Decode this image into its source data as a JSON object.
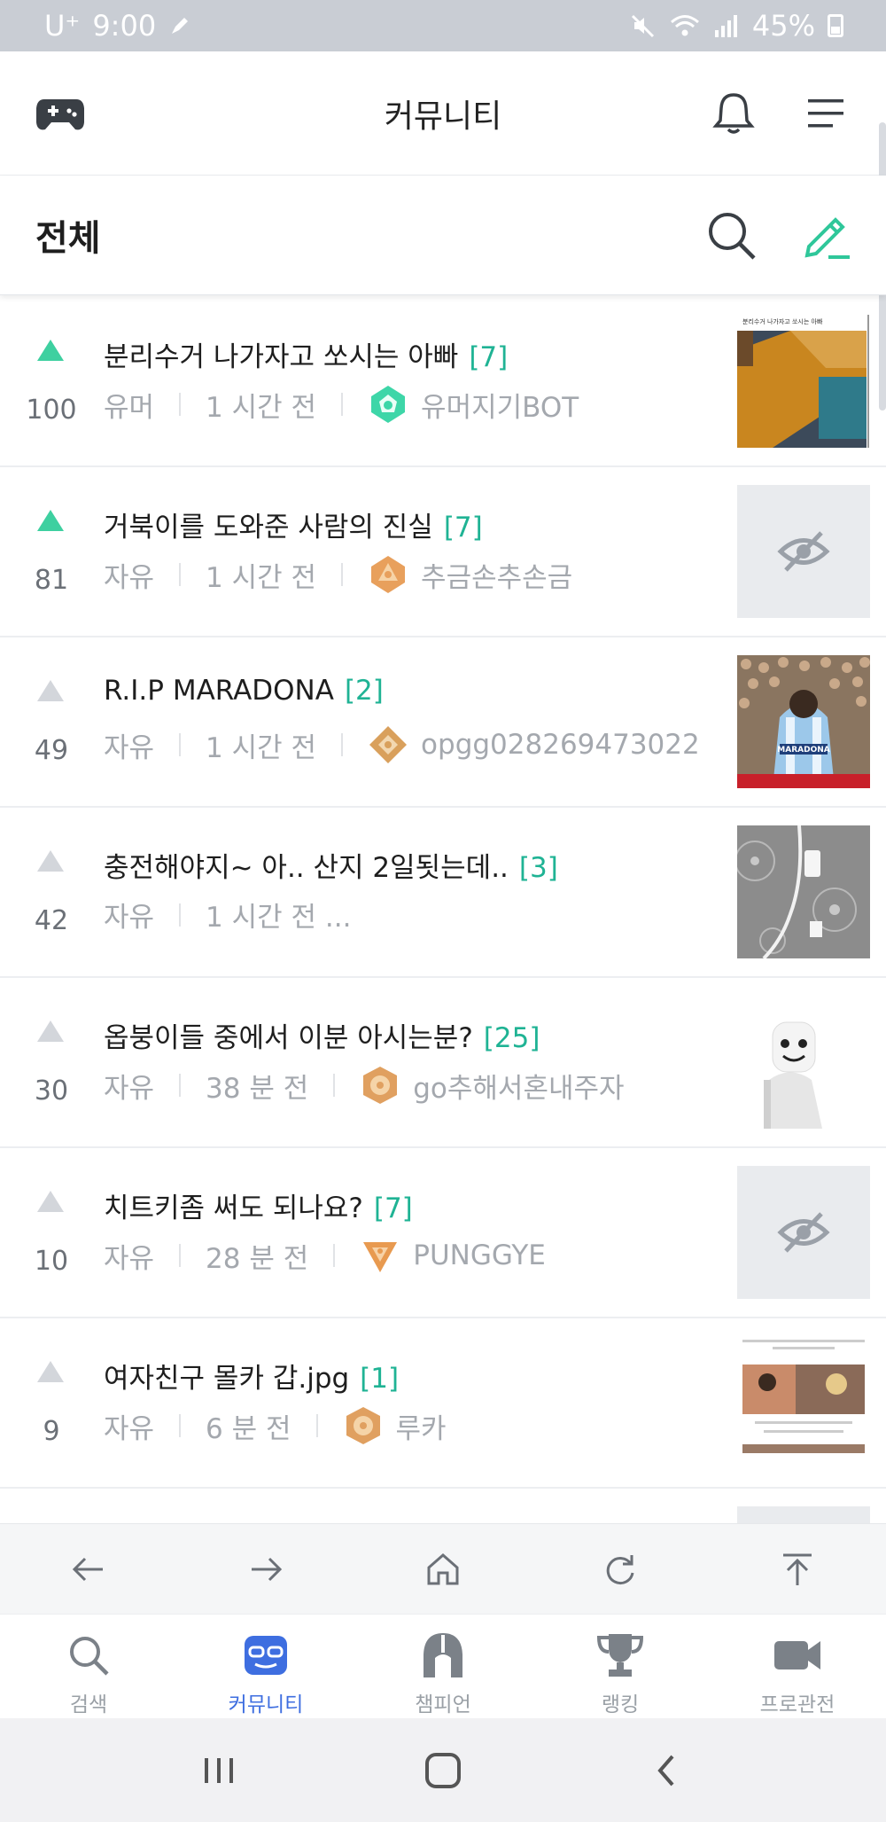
{
  "status_bar": {
    "carrier": "U⁺",
    "time": "9:00",
    "battery": "45%"
  },
  "header": {
    "title": "커뮤니티"
  },
  "section": {
    "title": "전체"
  },
  "posts": [
    {
      "votes": "100",
      "hot": true,
      "title": "분리수거 나가자고 쏘시는 아빠",
      "comments": "[7]",
      "category": "유머",
      "time": "1 시간 전",
      "author": "유머지기BOT",
      "badge_color": "#3ed6a8",
      "thumbnail": "photo",
      "thumbnail_caption": "분리수거 나가자고 쏘시는 아빠"
    },
    {
      "votes": "81",
      "hot": true,
      "title": "거북이를 도와준 사람의 진실",
      "comments": "[7]",
      "category": "자유",
      "time": "1 시간 전",
      "author": "추금손추손금",
      "badge_color": "#e8a05c",
      "thumbnail": "hidden"
    },
    {
      "votes": "49",
      "hot": false,
      "title": "R.I.P MARADONA",
      "comments": "[2]",
      "category": "자유",
      "time": "1 시간 전",
      "author": "opgg028269473022",
      "badge_color": "#d9a05c",
      "thumbnail": "photo",
      "thumbnail_caption": "MARADONA"
    },
    {
      "votes": "42",
      "hot": false,
      "title": "충전해야지~ 아.. 산지 2일됫는데..",
      "comments": "[3]",
      "category": "자유",
      "time": "1 시간 전 ...",
      "author": "",
      "badge_color": "",
      "thumbnail": "photo"
    },
    {
      "votes": "30",
      "hot": false,
      "title": "옵붕이들 중에서 이분 아시는분?",
      "comments": "[25]",
      "category": "자유",
      "time": "38 분 전",
      "author": "go추해서혼내주자",
      "badge_color": "#e0a060",
      "thumbnail": "photo"
    },
    {
      "votes": "10",
      "hot": false,
      "title": "치트키좀 써도 되나요?",
      "comments": "[7]",
      "category": "자유",
      "time": "28 분 전",
      "author": "PUNGGYE",
      "badge_color": "#e89a50",
      "thumbnail": "hidden"
    },
    {
      "votes": "9",
      "hot": false,
      "title": "여자친구 몰카 갑.jpg",
      "comments": "[1]",
      "category": "자유",
      "time": "6 분 전",
      "author": "루카",
      "badge_color": "#e0a060",
      "thumbnail": "photo"
    }
  ],
  "browser_bar": [
    "back-arrow-icon",
    "forward-arrow-icon",
    "home-icon",
    "refresh-icon",
    "scroll-top-icon"
  ],
  "tabs": [
    {
      "label": "검색",
      "icon": "search-icon",
      "active": false
    },
    {
      "label": "커뮤니티",
      "icon": "community-icon",
      "active": true
    },
    {
      "label": "챔피언",
      "icon": "champion-helmet-icon",
      "active": false
    },
    {
      "label": "랭킹",
      "icon": "trophy-icon",
      "active": false
    },
    {
      "label": "프로관전",
      "icon": "video-camera-icon",
      "active": false
    }
  ],
  "colors": {
    "accent": "#3ed0a0",
    "comment_count": "#1fb394",
    "tab_active": "#3e6ee0",
    "status_bar": "#c9cdd4"
  }
}
